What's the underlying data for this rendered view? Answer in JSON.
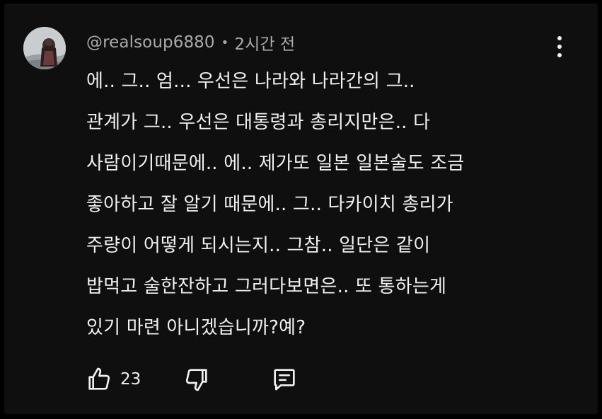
{
  "comment": {
    "author": "@realsoup6880",
    "separator": "•",
    "time": "2시간 전",
    "lines": [
      "에.. 그.. 엄... 우선은 나라와 나라간의 그..",
      "관계가 그.. 우선은 대통령과 총리지만은.. 다",
      "사람이기때문에.. 에.. 제가또 일본 일본술도 조금",
      "좋아하고 잘 알기 때문에.. 그.. 다카이치 총리가",
      "주량이 어떻게 되시는지.. 그참.. 일단은 같이",
      "밥먹고 술한잔하고 그러다보면은.. 또 통하는게",
      "있기 마련 아니겠습니까?예?"
    ]
  },
  "actions": {
    "like_count": "23",
    "icons": {
      "like": "thumbs-up-icon",
      "dislike": "thumbs-down-icon",
      "reply": "reply-icon",
      "more": "more-vert-icon"
    }
  },
  "colors": {
    "background": "#0f0f0f",
    "primary_text": "#f1f1f1",
    "secondary_text": "#aaaaaa"
  }
}
